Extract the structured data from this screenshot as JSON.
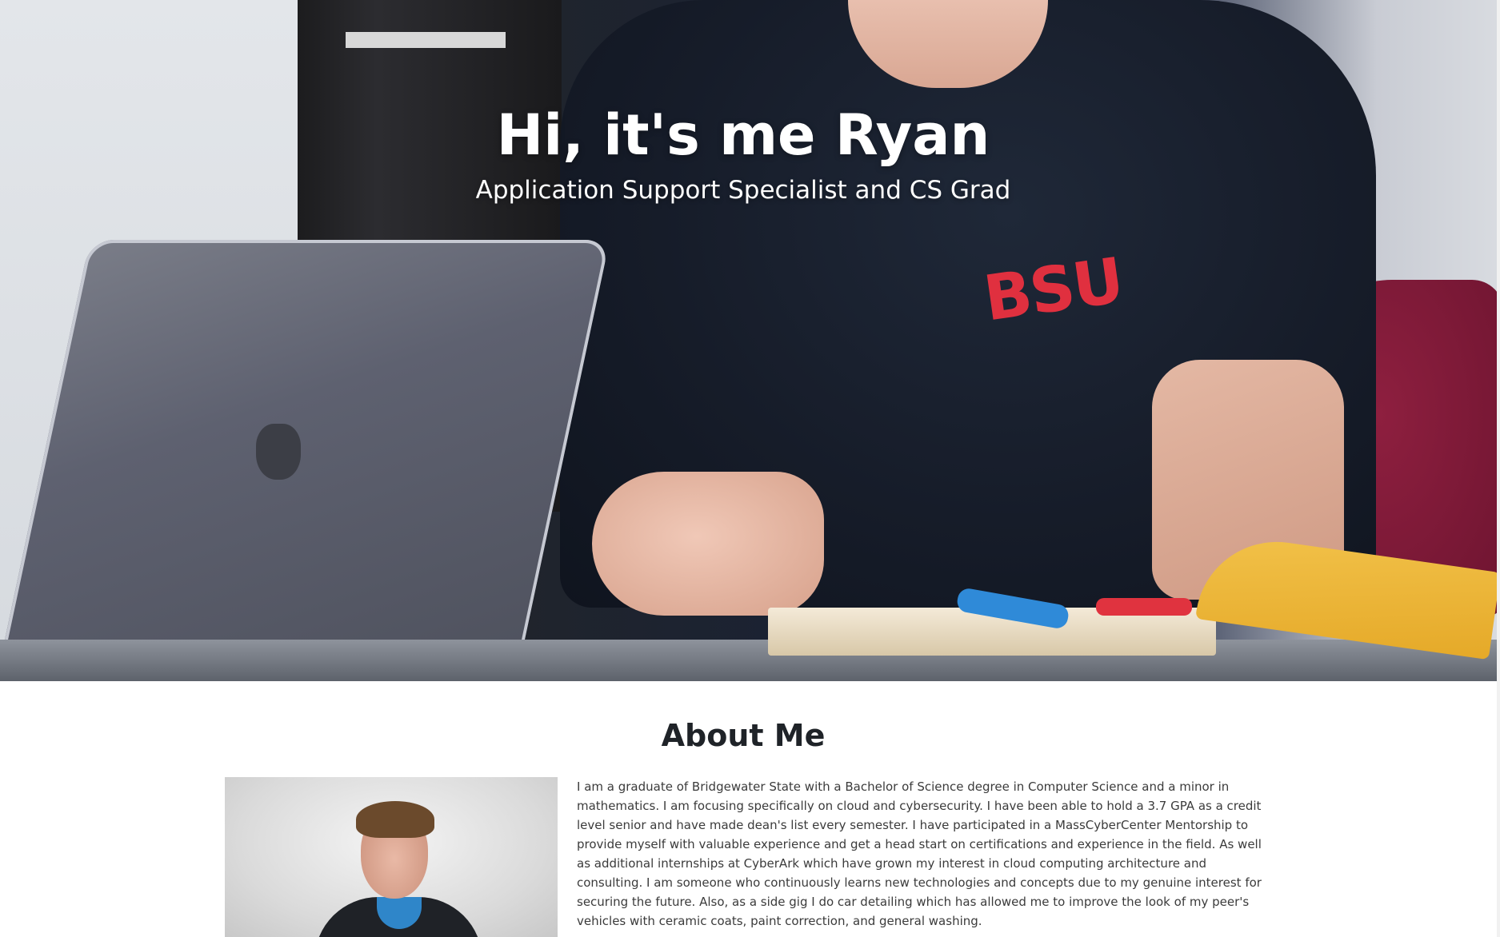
{
  "hero": {
    "title": "Hi, it's me Ryan",
    "subtitle": "Application Support Specialist and CS Grad",
    "shirt_logo_text": "BSU"
  },
  "about": {
    "title": "About Me",
    "text": "I am a graduate of Bridgewater State with a Bachelor of Science degree in Computer Science and a minor in mathematics. I am focusing specifically on cloud and cybersecurity. I have been able to hold a 3.7 GPA as a credit level senior and have made dean's list every semester. I have participated in a MassCyberCenter Mentorship to provide myself with valuable experience and get a head start on certifications and experience in the field. As well as additional internships at CyberArk which have grown my interest in cloud computing architecture and consulting. I am someone who continuously learns new technologies and concepts due to my genuine interest for securing the future. Also, as a side gig I do car detailing which has allowed me to improve the look of my peer's vehicles with ceramic coats, paint correction, and general washing."
  }
}
